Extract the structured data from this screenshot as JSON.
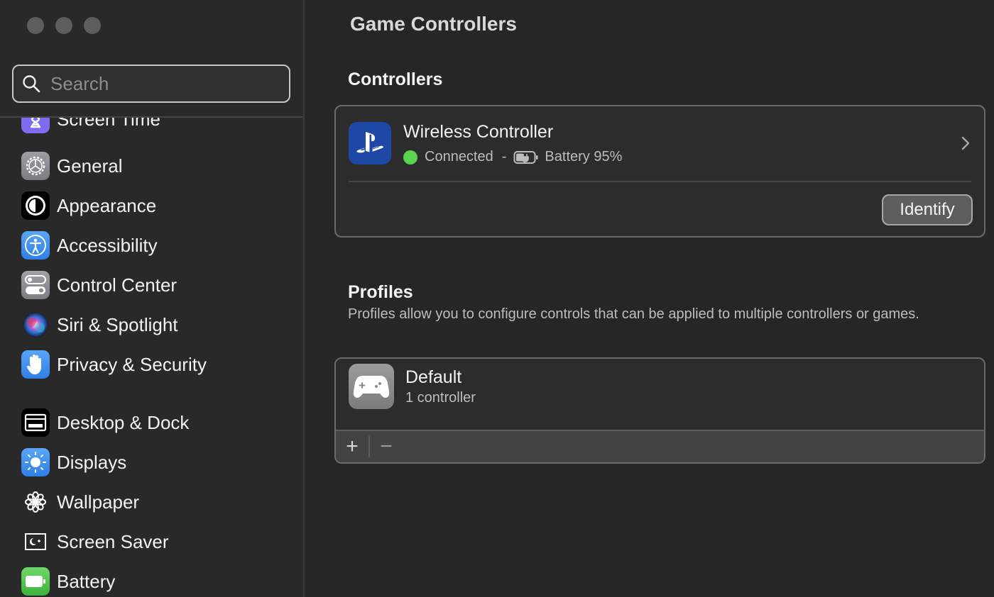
{
  "window": {
    "title": "Game Controllers"
  },
  "sidebar": {
    "search_placeholder": "Search",
    "items": [
      {
        "label": "Screen Time",
        "icon": "hourglass-icon",
        "color": "#6e5fd9"
      },
      {
        "label": "General",
        "icon": "gear-icon",
        "color": "#8e8e93"
      },
      {
        "label": "Appearance",
        "icon": "appearance-icon",
        "color": "#000000"
      },
      {
        "label": "Accessibility",
        "icon": "accessibility-icon",
        "color": "#3a8ef0"
      },
      {
        "label": "Control Center",
        "icon": "toggles-icon",
        "color": "#8e8e93"
      },
      {
        "label": "Siri & Spotlight",
        "icon": "siri-icon",
        "color": "#1c1c2e"
      },
      {
        "label": "Privacy & Security",
        "icon": "hand-icon",
        "color": "#3a8ef0"
      },
      {
        "label": "Desktop & Dock",
        "icon": "dock-icon",
        "color": "#000000"
      },
      {
        "label": "Displays",
        "icon": "sun-icon",
        "color": "#3a8ef0"
      },
      {
        "label": "Wallpaper",
        "icon": "flower-icon",
        "color": "#262626"
      },
      {
        "label": "Screen Saver",
        "icon": "screensaver-icon",
        "color": "#262626"
      },
      {
        "label": "Battery",
        "icon": "battery-icon",
        "color": "#4cc14a"
      }
    ]
  },
  "main": {
    "title": "Game Controllers",
    "controllers_section": {
      "title": "Controllers",
      "items": [
        {
          "name": "Wireless Controller",
          "icon": "playstation-icon",
          "status": "Connected",
          "status_color": "#5bd54e",
          "separator": "-",
          "battery": "Battery 95%",
          "identify_label": "Identify"
        }
      ]
    },
    "profiles_section": {
      "title": "Profiles",
      "description": "Profiles allow you to configure controls that can be applied to multiple controllers or games.",
      "items": [
        {
          "name": "Default",
          "subtitle": "1 controller",
          "icon": "gamepad-icon"
        }
      ],
      "add_label": "+",
      "remove_label": "−"
    }
  }
}
